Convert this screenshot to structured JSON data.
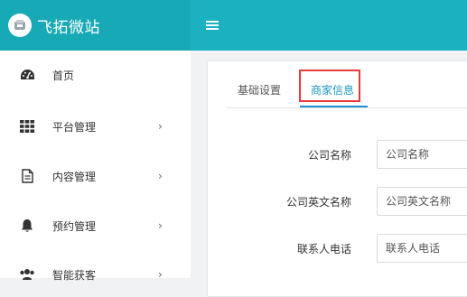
{
  "brand": {
    "title": "飞拓微站"
  },
  "sidebar": {
    "items": [
      {
        "label": "首页",
        "icon": "dashboard-icon",
        "has_arrow": false
      },
      {
        "label": "平台管理",
        "icon": "grid-icon",
        "has_arrow": true
      },
      {
        "label": "内容管理",
        "icon": "document-icon",
        "has_arrow": true
      },
      {
        "label": "预约管理",
        "icon": "bell-icon",
        "has_arrow": true
      },
      {
        "label": "智能获客",
        "icon": "users-icon",
        "has_arrow": true
      }
    ],
    "arrow_glyph": "›"
  },
  "tabs": [
    {
      "label": "基础设置",
      "active": false
    },
    {
      "label": "商家信息",
      "active": true
    }
  ],
  "form": {
    "fields": [
      {
        "label": "公司名称",
        "placeholder": "公司名称"
      },
      {
        "label": "公司英文名称",
        "placeholder": "公司英文名称"
      },
      {
        "label": "联系人电话",
        "placeholder": "联系人电话"
      }
    ]
  },
  "colors": {
    "brand_bg": "#17a9b6",
    "topbar_bg": "#1bb1c0",
    "active_tab": "#1a97c7",
    "highlight": "#e73a3a"
  }
}
